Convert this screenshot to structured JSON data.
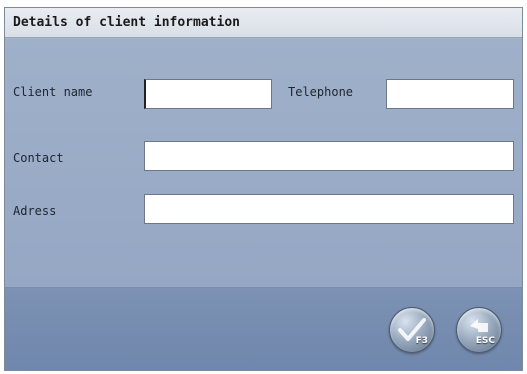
{
  "window": {
    "title": "Details of client information"
  },
  "form": {
    "client_name": {
      "label": "Client name",
      "value": ""
    },
    "telephone": {
      "label": "Telephone",
      "value": ""
    },
    "contact": {
      "label": "Contact",
      "value": ""
    },
    "address": {
      "label": "Adress",
      "value": ""
    }
  },
  "footer": {
    "confirm_button": {
      "key": "F3",
      "icon": "checkmark-icon"
    },
    "escape_button": {
      "key": "ESC",
      "icon": "return-arrow-icon"
    }
  },
  "colors": {
    "titlebar": "#dfe4eb",
    "form_background": "#9cadc8",
    "footer_background": "#758bae",
    "field_background": "#ffffff"
  }
}
